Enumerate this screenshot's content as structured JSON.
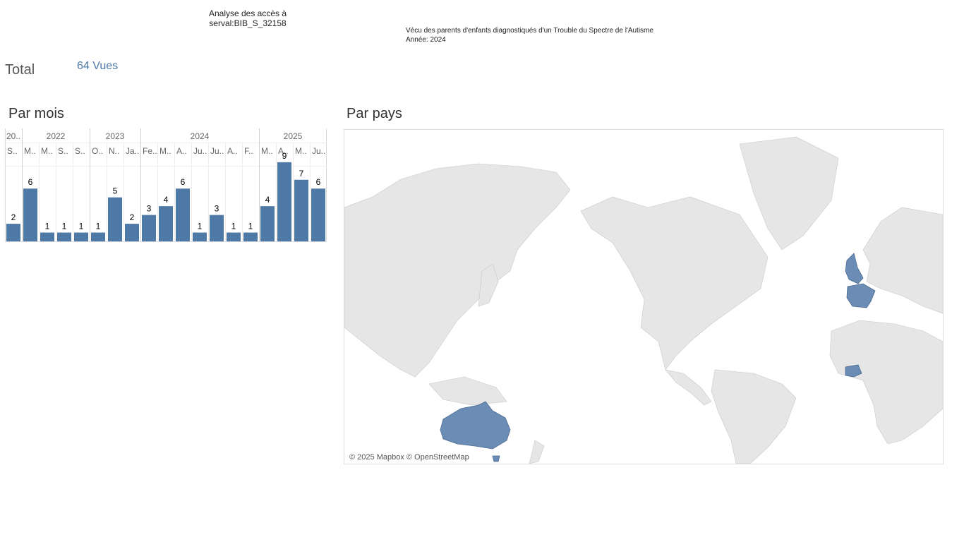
{
  "header": {
    "title_line1": "Analyse des accès à",
    "title_line2": "serval:BIB_S_32158"
  },
  "document": {
    "title": "Vécu des parents d'enfants diagnostiqués d'un Trouble du Spectre de l'Autisme",
    "year_line": "Année: 2024"
  },
  "total": {
    "label": "Total",
    "value": "64 Vues"
  },
  "sections": {
    "monthly": "Par mois",
    "country": "Par pays"
  },
  "colors": {
    "bar": "#4e79a7",
    "land": "#e6e6e6",
    "highlight": "#6a8cb5",
    "axis_text": "#666666"
  },
  "chart_data": {
    "type": "bar",
    "year_groups": [
      {
        "label": "20..",
        "count": 1
      },
      {
        "label": "2022",
        "count": 4
      },
      {
        "label": "2023",
        "count": 3
      },
      {
        "label": "2024",
        "count": 7
      },
      {
        "label": "2025",
        "count": 4
      }
    ],
    "categories": [
      "S..",
      "M..",
      "M..",
      "S..",
      "S..",
      "O..",
      "N..",
      "Ja..",
      "Fe..",
      "M..",
      "A..",
      "Ju..",
      "Ju..",
      "A..",
      "F..",
      "M..",
      "A..",
      "M..",
      "Ju.."
    ],
    "values": [
      2,
      6,
      1,
      1,
      1,
      1,
      5,
      2,
      3,
      4,
      6,
      1,
      3,
      1,
      1,
      4,
      9,
      7,
      6
    ],
    "ylim": [
      0,
      9
    ]
  },
  "map": {
    "highlighted_countries": [
      "United Kingdom",
      "France",
      "Switzerland",
      "Côte d'Ivoire",
      "Australia"
    ],
    "credit": "© 2025 Mapbox © OpenStreetMap"
  }
}
